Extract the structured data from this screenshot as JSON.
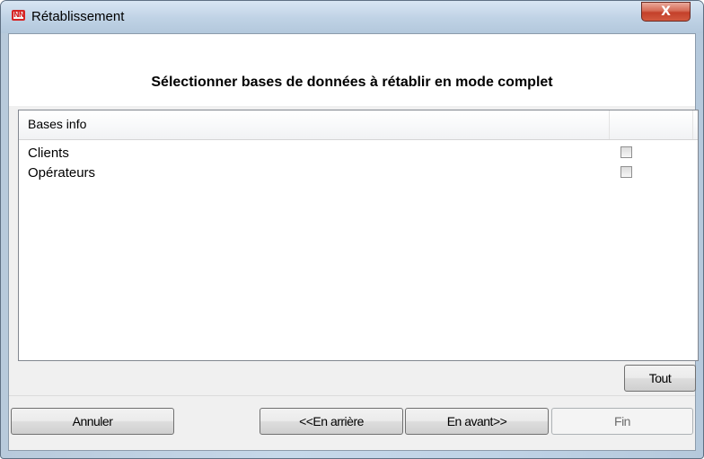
{
  "window": {
    "title": "Rétablissement",
    "app_icon_text": "NN",
    "close_label": "X"
  },
  "header": {
    "title": "Sélectionner bases de données à rétablir en mode complet"
  },
  "list": {
    "columns": [
      "Bases info",
      ""
    ],
    "rows": [
      {
        "label": "Clients",
        "checked": false
      },
      {
        "label": "Opérateurs",
        "checked": false
      }
    ]
  },
  "buttons": {
    "all_label": "Tout",
    "cancel_label": "Annuler",
    "back_label": "<<En arrière",
    "next_label": "En avant>>",
    "finish_label": "Fin"
  }
}
